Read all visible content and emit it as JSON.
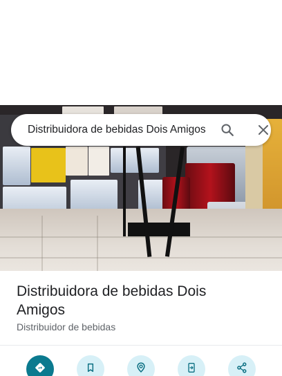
{
  "search": {
    "query": "Distribuidora de bebidas Dois Amigos"
  },
  "place": {
    "name": "Distribuidora de bebidas Dois Amigos",
    "category": "Distribuidor de bebidas"
  },
  "actions": [
    {
      "icon": "directions-icon"
    },
    {
      "icon": "save-bookmark-icon"
    },
    {
      "icon": "nearby-icon"
    },
    {
      "icon": "send-to-phone-icon"
    },
    {
      "icon": "share-icon"
    }
  ],
  "colors": {
    "primary_action": "#0b7a8f",
    "secondary_action": "#d7f0f7",
    "secondary_icon": "#0b6f82"
  }
}
